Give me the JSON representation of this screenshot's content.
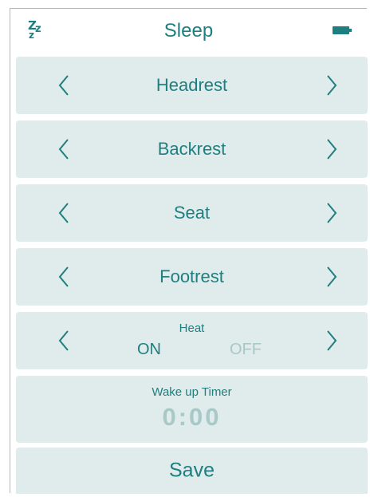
{
  "header": {
    "title": "Sleep",
    "left_icon": "sleep-zzz-icon",
    "right_icon": "battery-icon"
  },
  "controls": [
    {
      "label": "Headrest"
    },
    {
      "label": "Backrest"
    },
    {
      "label": "Seat"
    },
    {
      "label": "Footrest"
    }
  ],
  "heat": {
    "title": "Heat",
    "on_label": "ON",
    "off_label": "OFF",
    "selected": "ON"
  },
  "timer": {
    "title": "Wake up Timer",
    "value": "0:00"
  },
  "save": {
    "label": "Save"
  },
  "colors": {
    "accent": "#1e7f80",
    "panel_bg": "#e0ebeb",
    "muted": "#a9c8c8"
  }
}
